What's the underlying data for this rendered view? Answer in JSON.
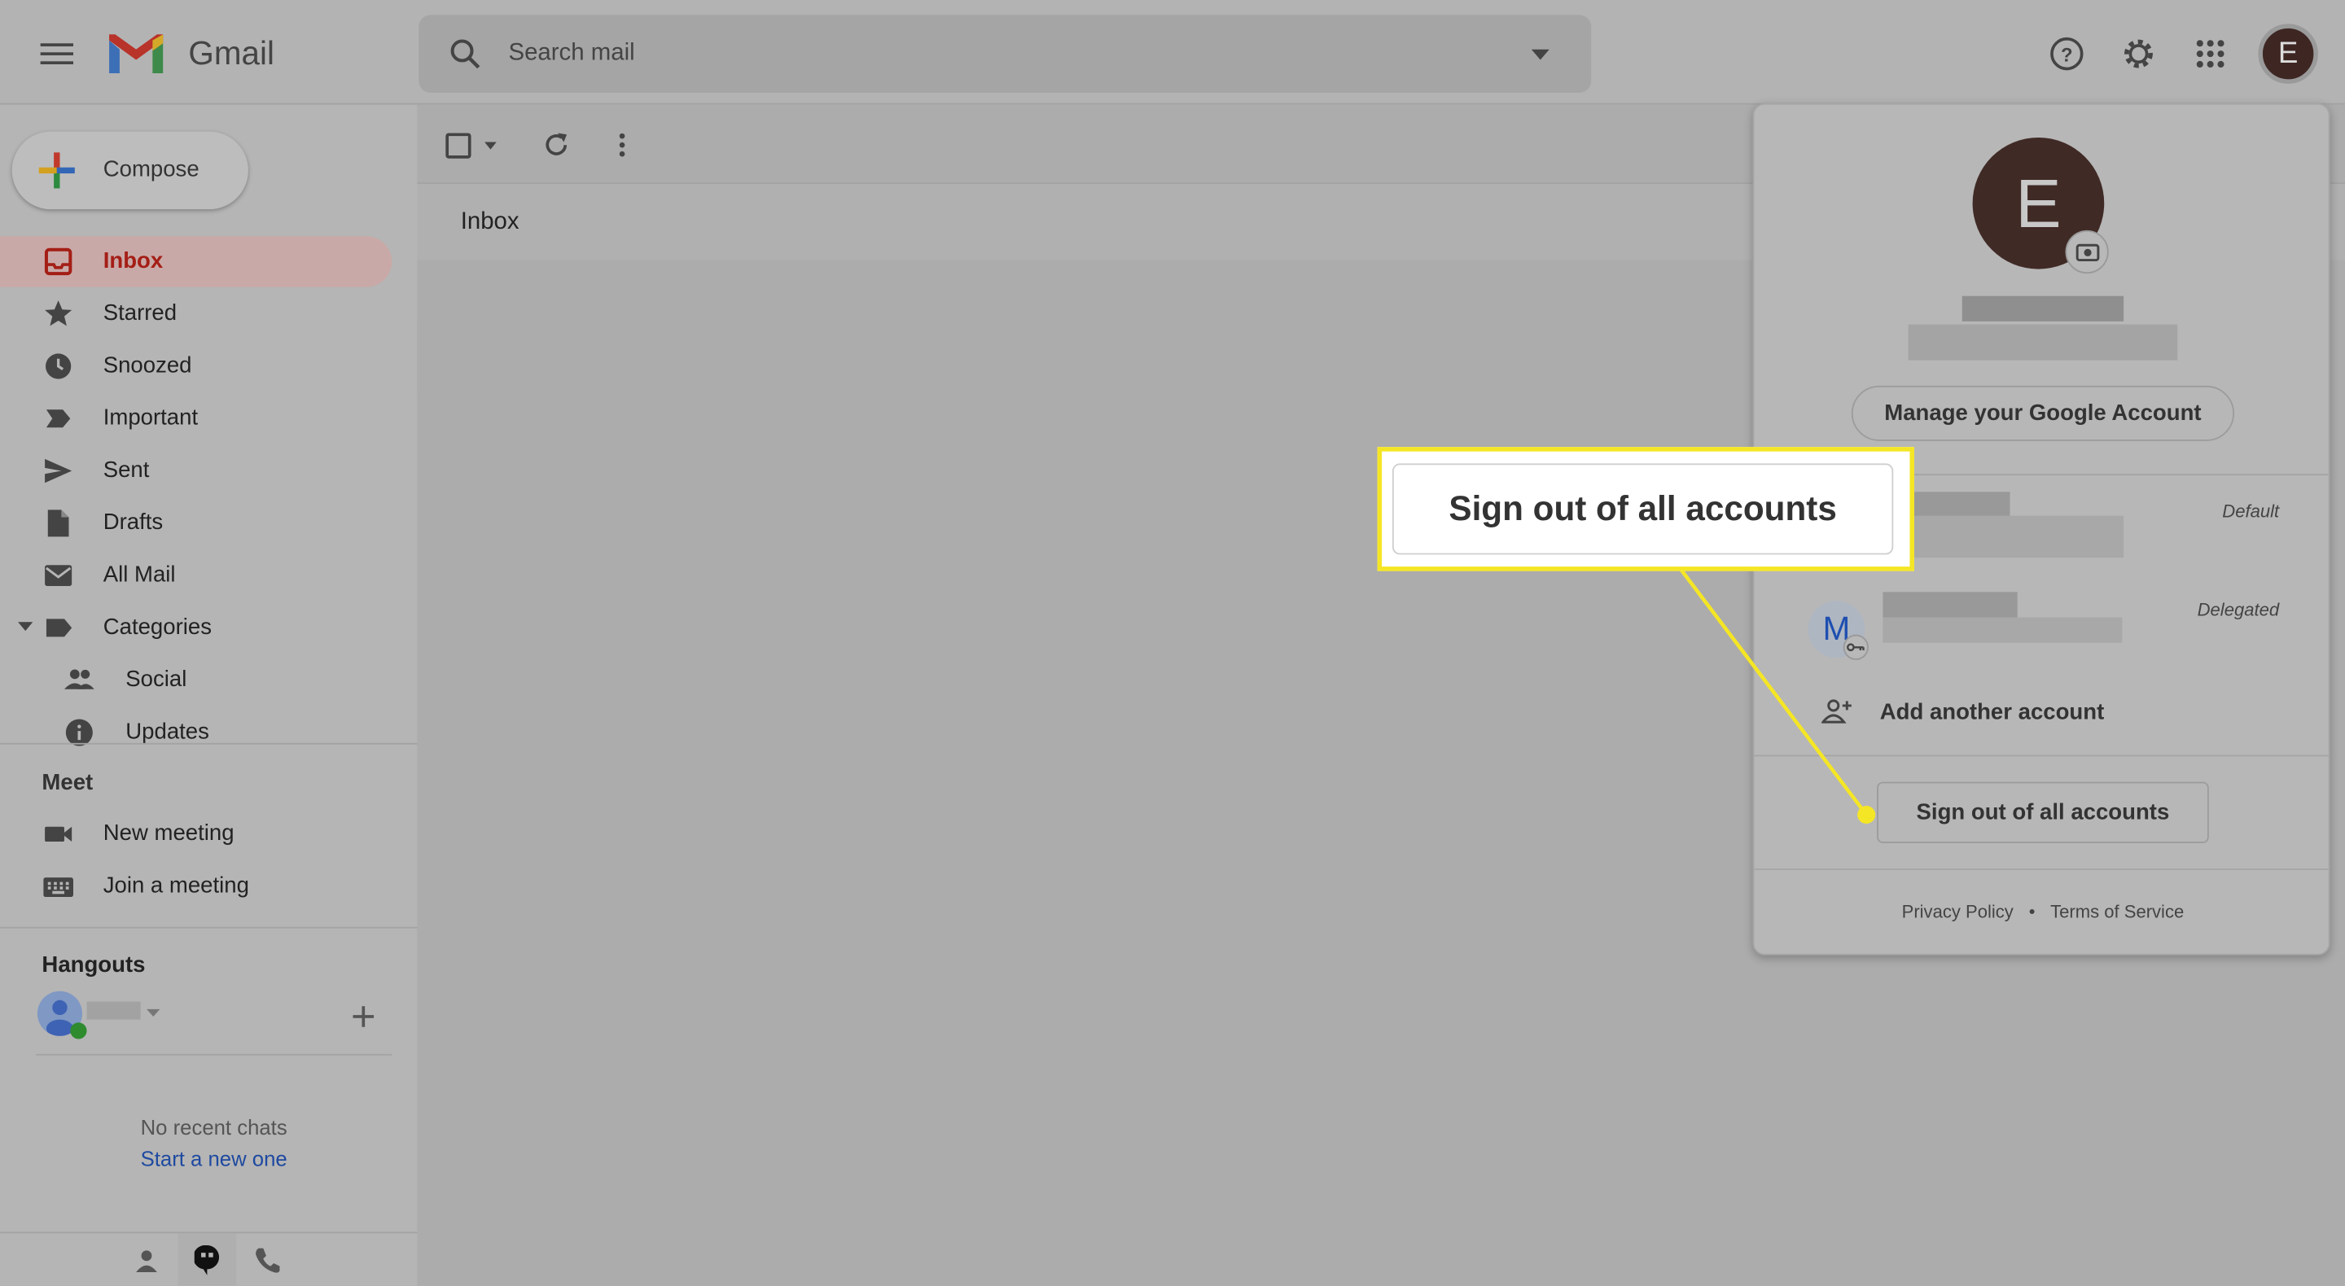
{
  "header": {
    "app_name": "Gmail",
    "search_placeholder": "Search mail",
    "avatar_letter": "E"
  },
  "sidebar": {
    "compose": "Compose",
    "items": [
      {
        "label": "Inbox",
        "icon": "inbox-icon",
        "selected": true
      },
      {
        "label": "Starred",
        "icon": "star-icon"
      },
      {
        "label": "Snoozed",
        "icon": "clock-icon"
      },
      {
        "label": "Important",
        "icon": "important-icon"
      },
      {
        "label": "Sent",
        "icon": "send-icon"
      },
      {
        "label": "Drafts",
        "icon": "draft-icon"
      },
      {
        "label": "All Mail",
        "icon": "mail-icon"
      },
      {
        "label": "Categories",
        "icon": "label-icon"
      },
      {
        "label": "Social",
        "icon": "people-icon"
      },
      {
        "label": "Updates",
        "icon": "info-icon"
      }
    ],
    "meet": {
      "title": "Meet",
      "new_meeting": "New meeting",
      "join_meeting": "Join a meeting"
    },
    "hangouts": {
      "title": "Hangouts",
      "no_chats": "No recent chats",
      "start_new": "Start a new one"
    }
  },
  "main": {
    "tab": "Inbox"
  },
  "account_popup": {
    "avatar_letter": "E",
    "manage": "Manage your Google Account",
    "accounts": [
      {
        "badge": "Default"
      },
      {
        "avatar_letter": "M",
        "badge": "Delegated"
      }
    ],
    "add_account": "Add another account",
    "sign_out": "Sign out of all accounts",
    "privacy": "Privacy Policy",
    "separator": "•",
    "terms": "Terms of Service"
  },
  "callout": {
    "text": "Sign out of all accounts",
    "color": "#f5e625"
  }
}
